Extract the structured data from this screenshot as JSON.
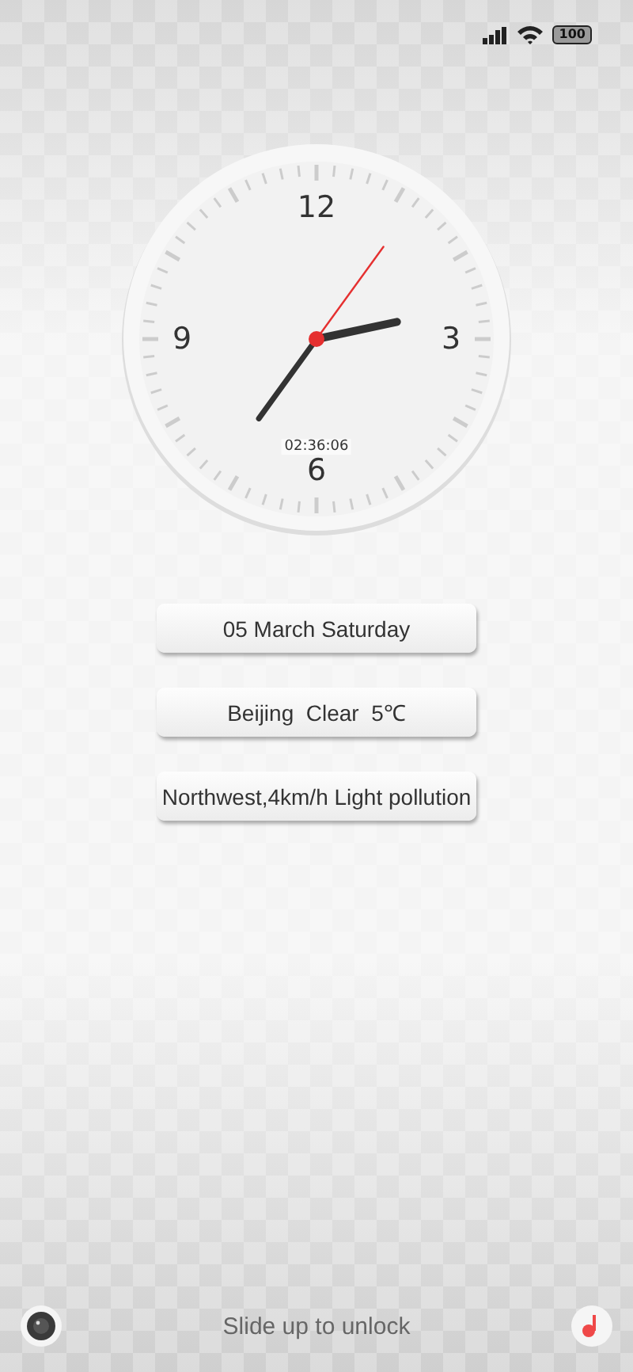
{
  "status_bar": {
    "battery": "100"
  },
  "clock": {
    "numerals": [
      "12",
      "3",
      "6",
      "9"
    ],
    "digital_time": "02:36:06"
  },
  "info_pills": [
    "05 March Saturday",
    "Beijing  Clear  5℃",
    "Northwest,4km/h Light pollution"
  ],
  "bottom": {
    "hint": "Slide up to unlock"
  }
}
